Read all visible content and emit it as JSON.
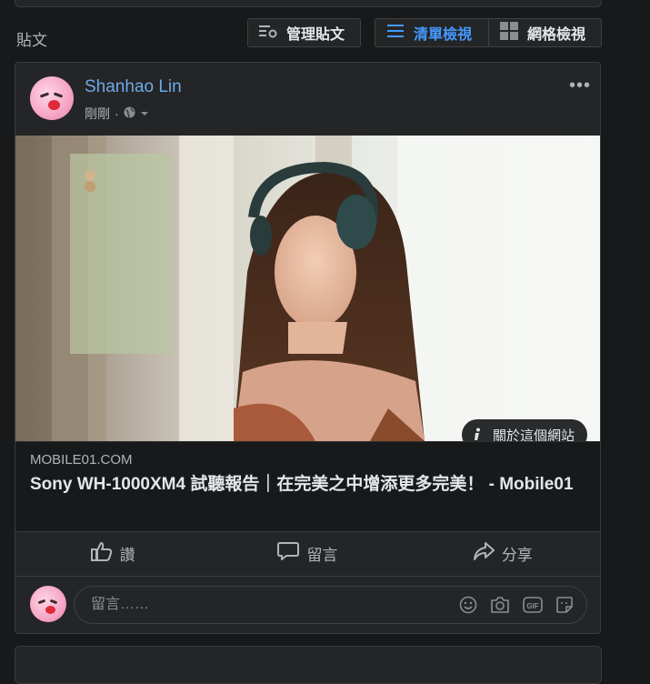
{
  "section": {
    "title": "貼文"
  },
  "toolbar": {
    "manage_label": "管理貼文",
    "list_label": "清單檢視",
    "grid_label": "網格檢視",
    "accent": "#4599ff"
  },
  "post": {
    "author": "Shanhao Lin",
    "time": "剛剛",
    "separator": "·",
    "more_label": "•••",
    "about_label": "關於這個網站",
    "link": {
      "domain": "MOBILE01.COM",
      "headline": "Sony WH-1000XM4 試聽報告｜在完美之中增添更多完美！ - Mobile01"
    },
    "actions": {
      "like": "讚",
      "comment": "留言",
      "share": "分享"
    },
    "comment_placeholder": "留言……",
    "icons": [
      "globe-icon",
      "thumbs-up-icon",
      "comment-icon",
      "share-icon",
      "emoji-icon",
      "camera-icon",
      "gif-icon",
      "sticker-icon"
    ]
  }
}
